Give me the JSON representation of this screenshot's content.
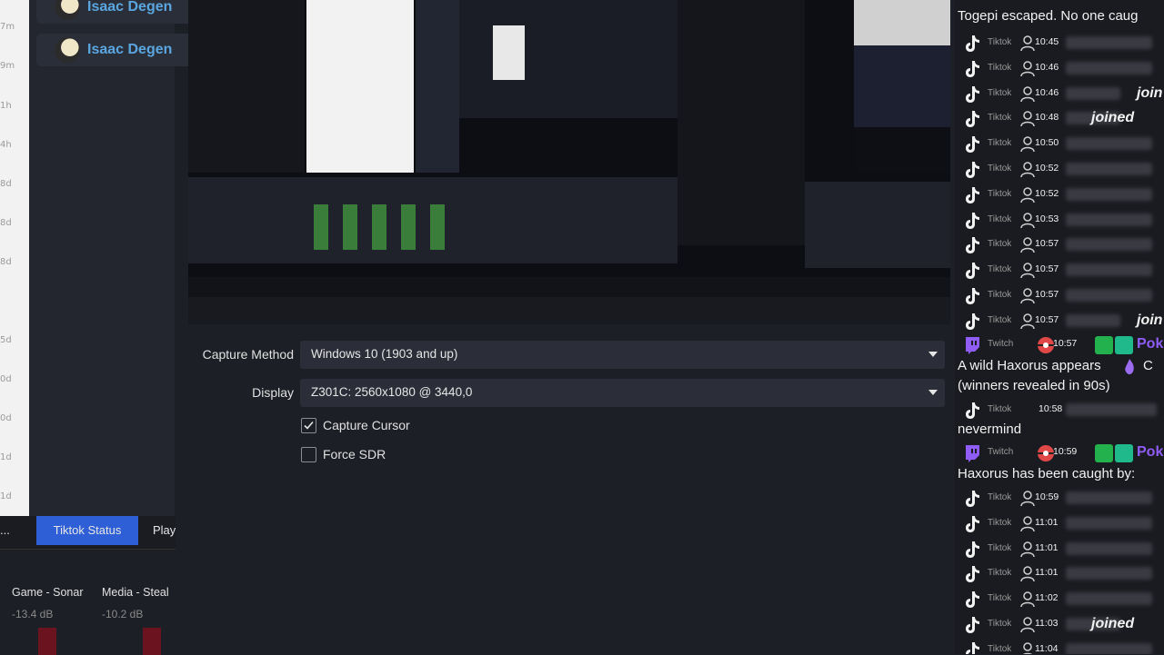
{
  "left_strip": {
    "time_labels": [
      "7m",
      "9m",
      "1h",
      "4h",
      "8d",
      "8d",
      "8d",
      "5d",
      "0d",
      "0d",
      "1d",
      "1d"
    ]
  },
  "left_panel": {
    "users": [
      "Isaac Degen",
      "Isaac Degen"
    ]
  },
  "dock_tabs": {
    "tiktok_status": "Tiktok Status",
    "play": "Play",
    "more": "..."
  },
  "mixer": {
    "channels": [
      {
        "name": "Game - Sonar",
        "db": "-13.4 dB"
      },
      {
        "name": "Media - Steal",
        "db": "-10.2 dB"
      }
    ]
  },
  "properties": {
    "capture_method_label": "Capture Method",
    "capture_method_value": "Windows 10 (1903 and up)",
    "display_label": "Display",
    "display_value": "Z301C: 2560x1080 @ 3440,0",
    "capture_cursor_label": "Capture Cursor",
    "capture_cursor_checked": true,
    "force_sdr_label": "Force SDR",
    "force_sdr_checked": false
  },
  "chat": {
    "top_message": "Togepi escaped. No one caug",
    "platform_tiktok": "Tiktok",
    "platform_twitch": "Twitch",
    "joined": "joined",
    "join_partial": "join",
    "poke_partial": "Pok",
    "rows_a": [
      {
        "time": "10:45"
      },
      {
        "time": "10:46"
      },
      {
        "time": "10:46",
        "tag": "join"
      },
      {
        "time": "10:48",
        "tag": "joined"
      },
      {
        "time": "10:50"
      },
      {
        "time": "10:52"
      },
      {
        "time": "10:52"
      },
      {
        "time": "10:53"
      },
      {
        "time": "10:57"
      },
      {
        "time": "10:57"
      },
      {
        "time": "10:57"
      },
      {
        "time": "10:57",
        "tag": "join"
      }
    ],
    "twitch_1_time": "10:57",
    "msg_haxorus_1": "A wild Haxorus appears",
    "msg_haxorus_1b": "C",
    "msg_winners": "(winners revealed in 90s)",
    "tiktok_mid_time": "10:58",
    "msg_nevermind": "nevermind",
    "twitch_2_time": "10:59",
    "msg_caught": "Haxorus has been caught by:",
    "rows_b": [
      {
        "time": "10:59"
      },
      {
        "time": "11:01"
      },
      {
        "time": "11:01"
      },
      {
        "time": "11:01"
      },
      {
        "time": "11:02"
      },
      {
        "time": "11:03",
        "tag": "joined"
      },
      {
        "time": "11:04"
      }
    ]
  },
  "colors": {
    "accent_blue": "#2f5fd6",
    "twitch_purple": "#8f5cf5",
    "link_blue": "#5aa6e0"
  }
}
